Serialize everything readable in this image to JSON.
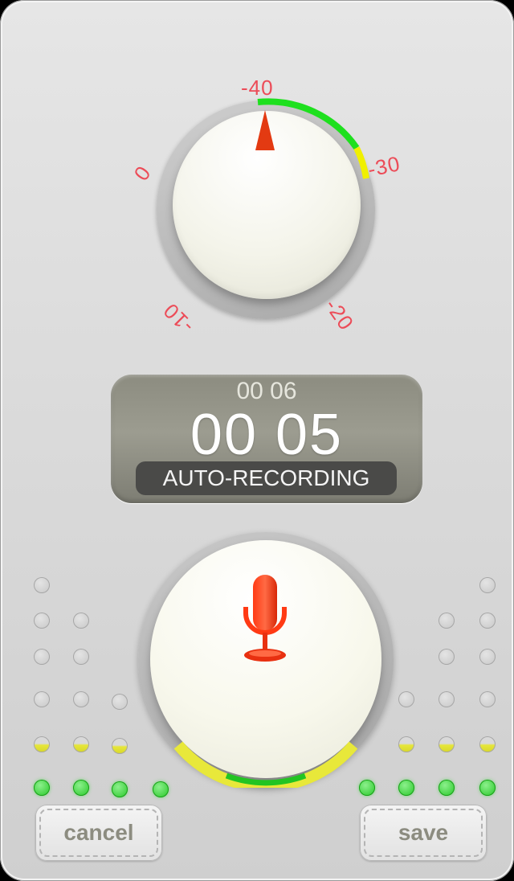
{
  "dial": {
    "labels": {
      "minus40": "-40",
      "minus30": "-30",
      "minus20": "-20",
      "minus10": "-10",
      "zero": "0"
    },
    "colors": {
      "green": "#1ee01e",
      "yellow": "#f0f000",
      "pointer": "#e33a12",
      "label": "#ec4c58"
    }
  },
  "display": {
    "elapsed": "00 06",
    "remaining": "00 05",
    "status": "AUTO-RECORDING"
  },
  "record_button": {
    "icon": "microphone-icon",
    "level_colors": [
      "#e8e83a",
      "#22c422"
    ]
  },
  "buttons": {
    "cancel": "cancel",
    "save": "save"
  },
  "meters": {
    "left_levels": [
      "green",
      "green",
      "green",
      "green"
    ],
    "right_levels": [
      "green",
      "green",
      "green",
      "green"
    ]
  }
}
